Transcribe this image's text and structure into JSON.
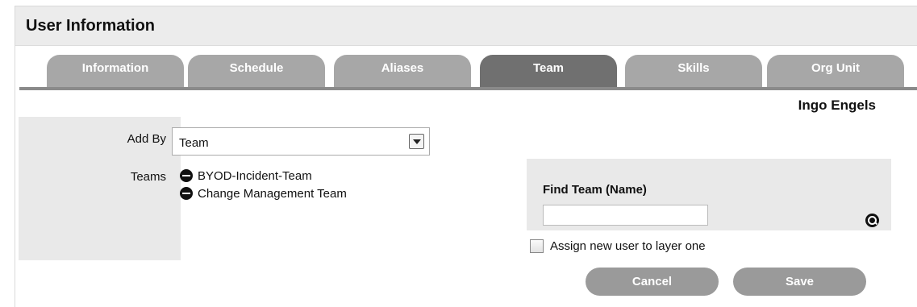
{
  "header": {
    "title": "User Information"
  },
  "tabs": [
    {
      "label": "Information",
      "active": false
    },
    {
      "label": "Schedule",
      "active": false
    },
    {
      "label": "Aliases",
      "active": false
    },
    {
      "label": "Team",
      "active": true
    },
    {
      "label": "Skills",
      "active": false
    },
    {
      "label": "Org Unit",
      "active": false
    }
  ],
  "user": {
    "name": "Ingo Engels"
  },
  "form": {
    "add_by_label": "Add By",
    "add_by_value": "Team",
    "teams_label": "Teams",
    "teams": [
      {
        "name": "BYOD-Incident-Team"
      },
      {
        "name": "Change Management Team"
      }
    ],
    "find_label": "Find Team (Name)",
    "find_value": "",
    "assign_label": "Assign new user to layer one",
    "assign_checked": false
  },
  "buttons": {
    "cancel_label": "Cancel",
    "save_label": "Save"
  },
  "colors": {
    "tab_inactive": "#a7a7a7",
    "tab_active": "#707070",
    "button": "#9a9a9a",
    "panel_bg": "#e9e9e9"
  },
  "icons": {
    "remove": "minus-circle-icon",
    "search": "search-icon",
    "dropdown": "chevron-down-icon"
  }
}
